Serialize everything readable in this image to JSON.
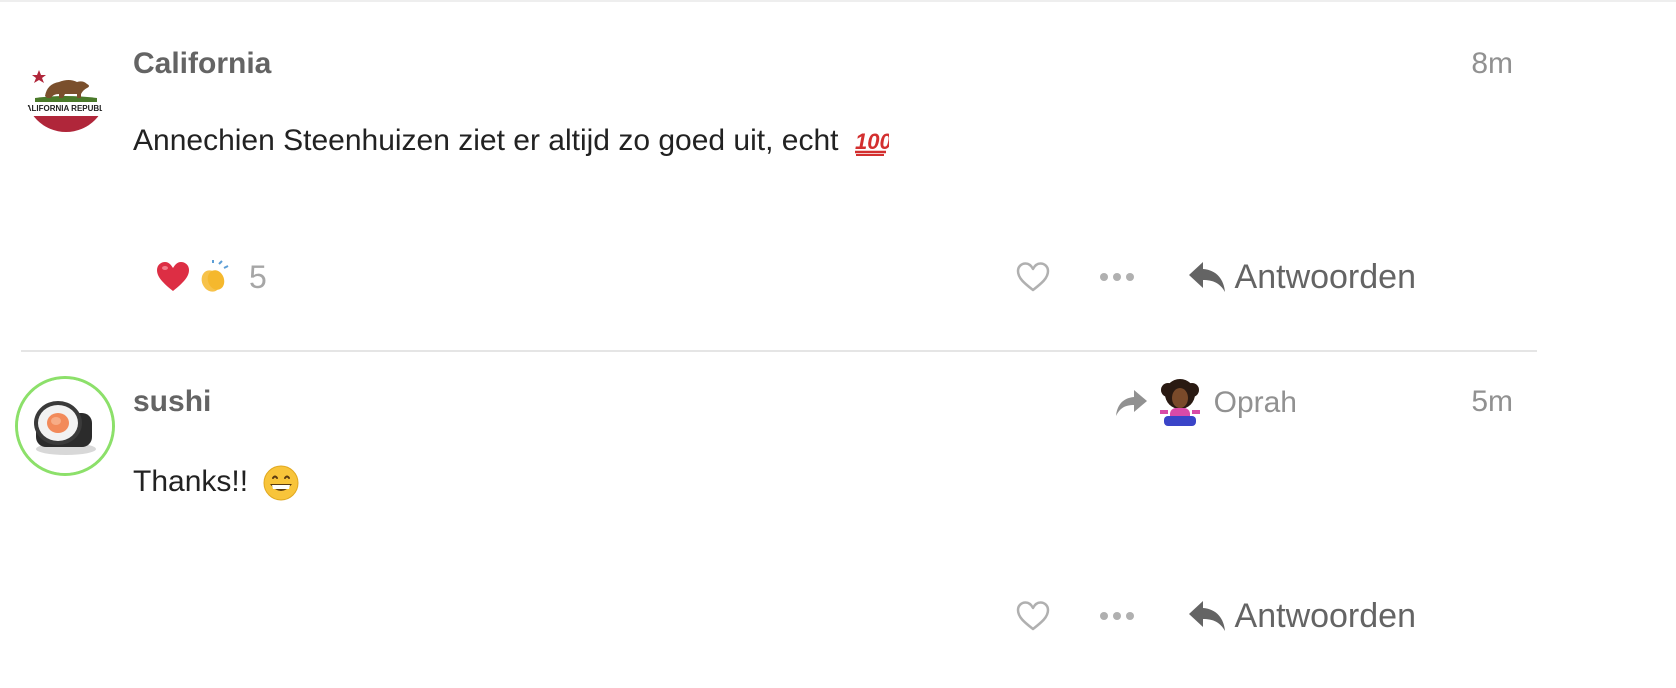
{
  "posts": [
    {
      "username": "California",
      "time": "8m",
      "text": "Annechien Steenhuizen ziet er altijd zo goed uit, echt",
      "avatar_text": "CALIFORNIA REPUBLIC",
      "reactions": {
        "icons": [
          "heart-emoji",
          "clapping-hands-emoji"
        ],
        "count": "5"
      },
      "reply_label": "Antwoorden"
    },
    {
      "username": "sushi",
      "time": "5m",
      "text": "Thanks!!",
      "reply_to": "Oprah",
      "reply_label": "Antwoorden"
    }
  ],
  "colors": {
    "username": "#646464",
    "meta": "#919191",
    "icon": "#b0b0b0",
    "avatar_ring": "#8ce06a",
    "divider": "#e5e5e5"
  }
}
